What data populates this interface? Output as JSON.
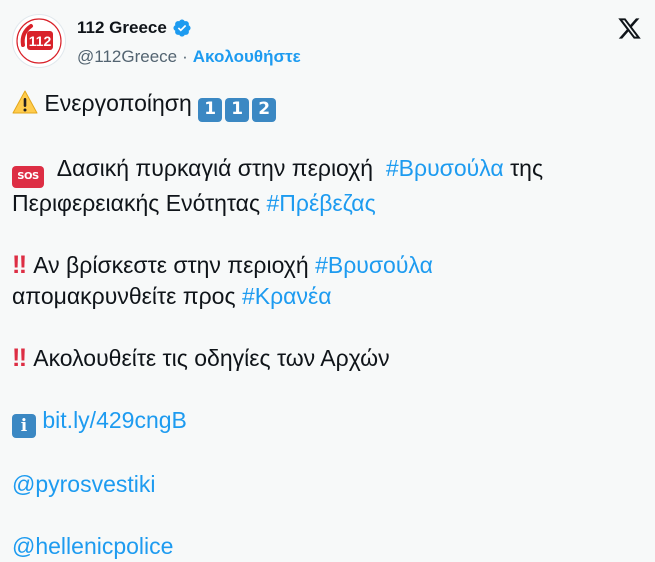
{
  "author": {
    "name": "112 Greece",
    "handle": "@112Greece",
    "separator": "·",
    "follow_label": "Ακολουθήστε",
    "avatar_text": "112",
    "verified_color": "#1d9bf0"
  },
  "tweet": {
    "line1_text": "Ενεργοποίηση",
    "line1_digits": [
      "1",
      "1",
      "2"
    ],
    "sos_label": "SOS",
    "line2_text": "Δασική πυρκαγιά στην περιοχή",
    "line2_tag1": "#Βρυσούλα",
    "line2_mid": "της",
    "line3_text": "Περιφερειακής Ενότητας",
    "line3_tag": "#Πρέβεζας",
    "bang": "‼",
    "line4_text": "Αν βρίσκεστε στην περιοχή",
    "line4_tag": "#Βρυσούλα",
    "line5_text": "απομακρυνθείτε προς",
    "line5_tag": "#Κρανέα",
    "line6_text": "Ακολουθείτε τις οδηγίες των Αρχών",
    "info_label": "i",
    "link": "bit.ly/429cngB",
    "mention1": "@pyrosvestiki",
    "mention2": "@hellenicpolice"
  },
  "colors": {
    "link": "#1d9bf0",
    "keycap": "#3b88c3",
    "sos": "#dd2e44"
  },
  "icons": [
    "avatar-112-logo",
    "verified-badge-icon",
    "x-logo-icon",
    "warning-icon",
    "keycap-digit-icon",
    "sos-icon",
    "double-exclamation-icon",
    "information-icon"
  ]
}
